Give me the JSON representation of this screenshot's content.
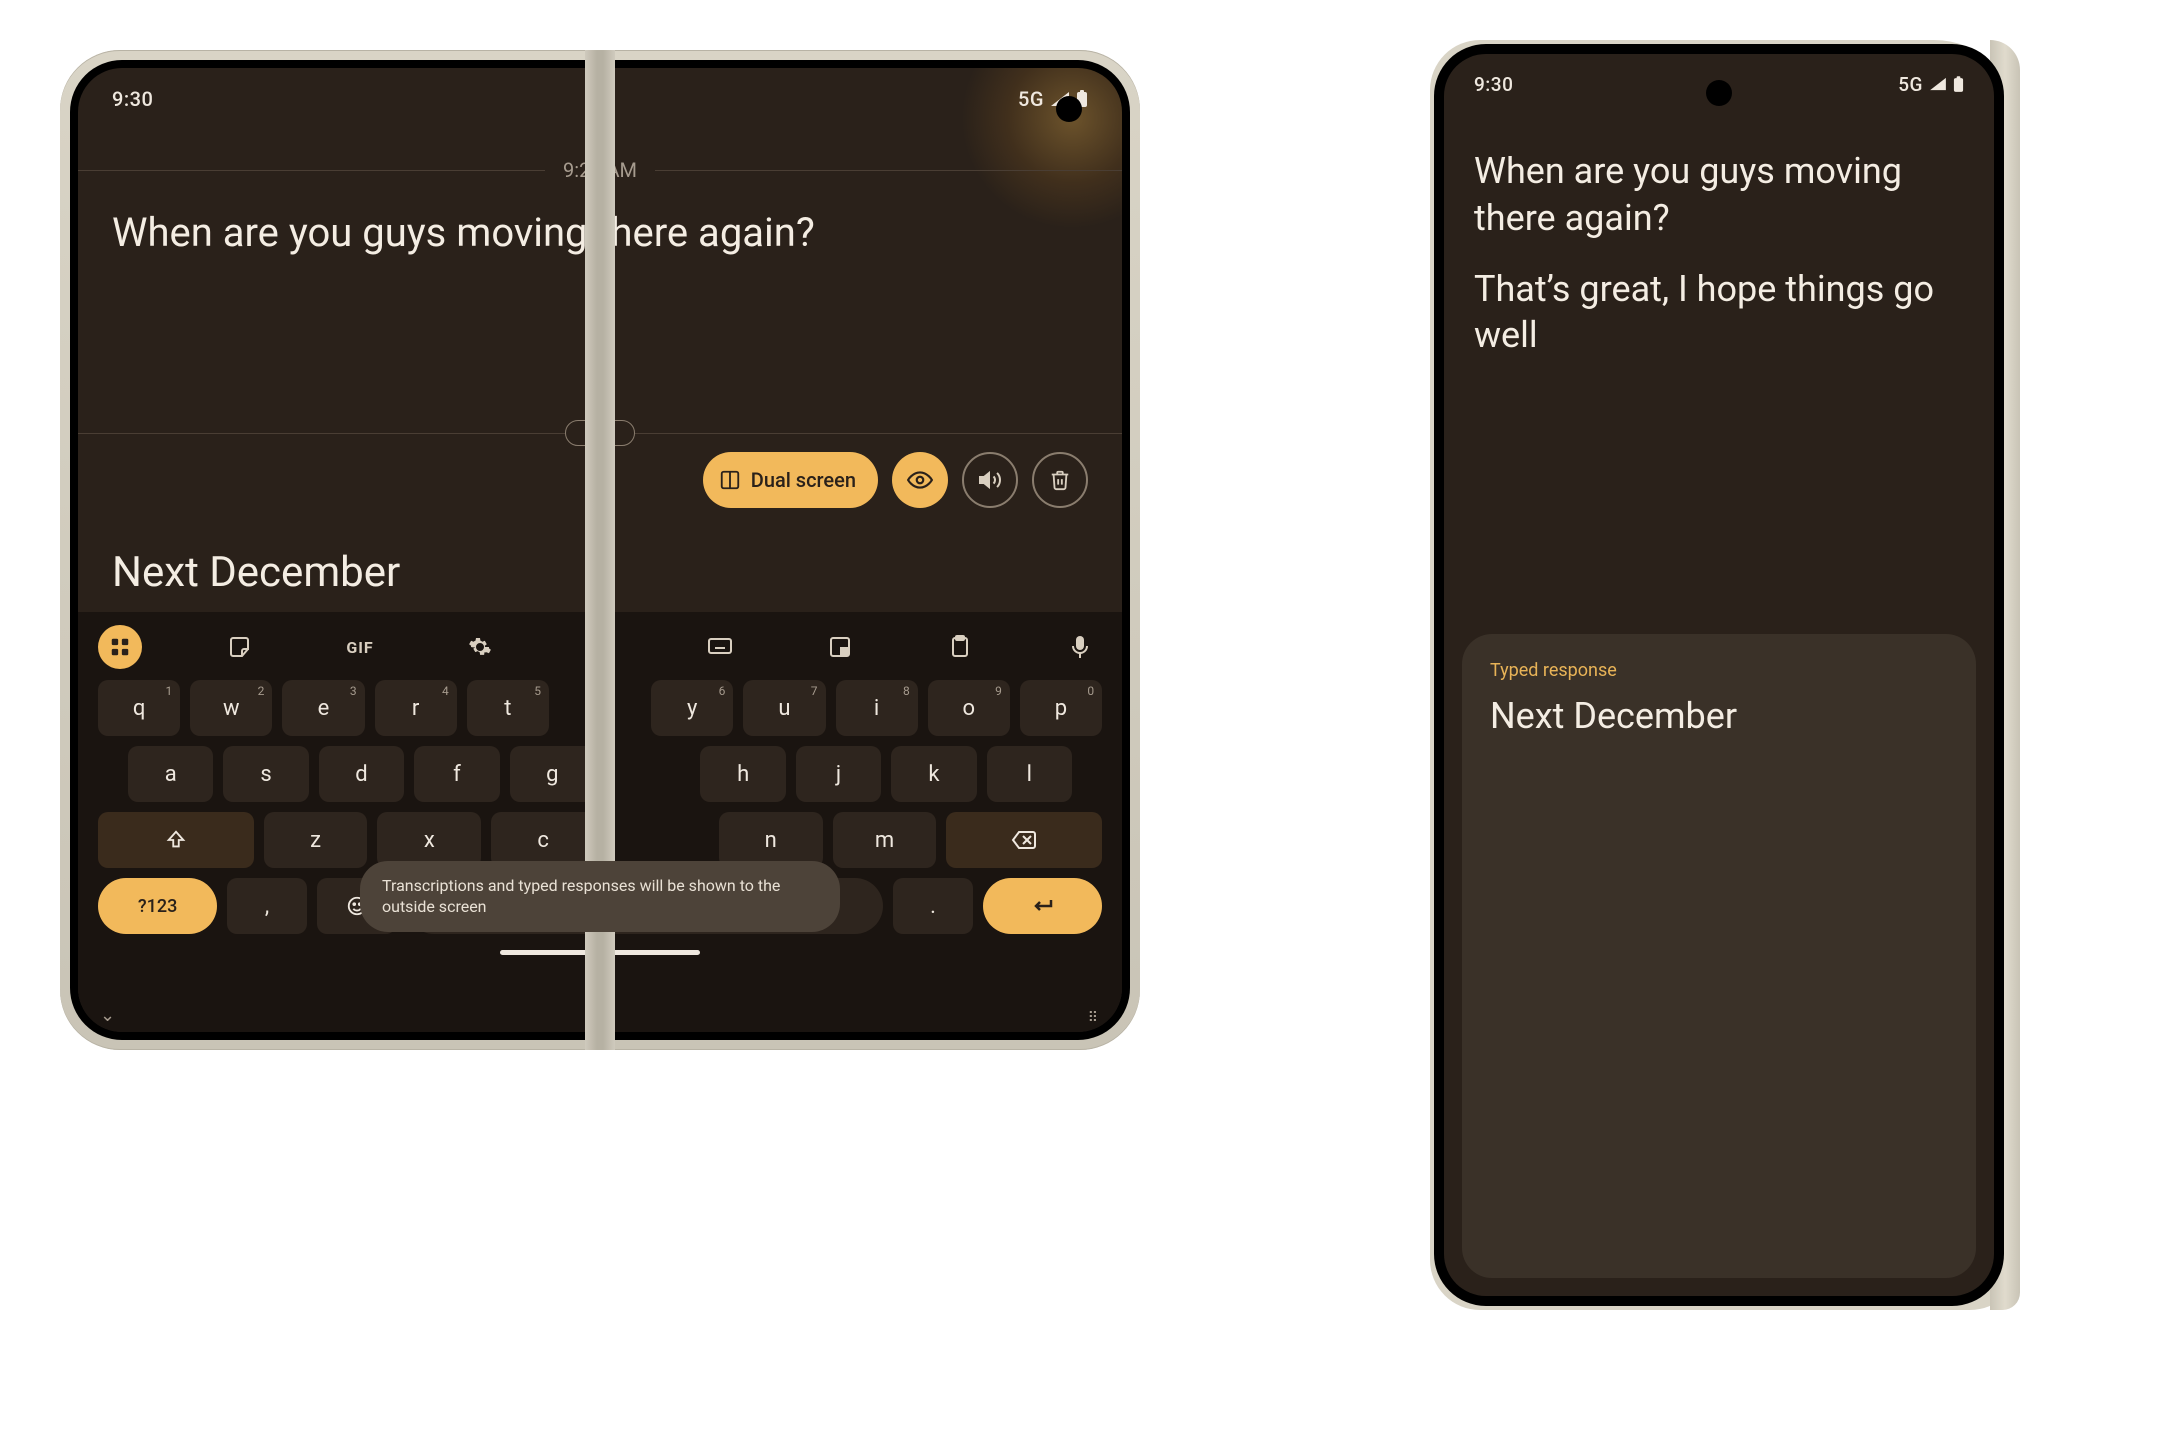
{
  "status": {
    "time": "9:30",
    "network": "5G"
  },
  "inner": {
    "timestamp": "9:29 AM",
    "transcript": "When are you guys moving there again?",
    "dual_screen_label": "Dual screen",
    "reply_text": "Next December",
    "toast": "Transcriptions and typed responses will be shown to the outside screen",
    "gif_label": "GIF",
    "num_key_label": "?123",
    "keys_row1_left": [
      "q",
      "w",
      "e",
      "r",
      "t"
    ],
    "keys_row1_left_sup": [
      "1",
      "2",
      "3",
      "4",
      "5"
    ],
    "keys_row1_right": [
      "y",
      "u",
      "i",
      "o",
      "p"
    ],
    "keys_row1_right_sup": [
      "6",
      "7",
      "8",
      "9",
      "0"
    ],
    "keys_row2_left": [
      "a",
      "s",
      "d",
      "f",
      "g"
    ],
    "keys_row2_right": [
      "h",
      "j",
      "k",
      "l"
    ],
    "keys_row3_left": [
      "z",
      "x",
      "c"
    ],
    "keys_row3_right": [
      "n",
      "m"
    ],
    "punct_comma": ",",
    "punct_period": "."
  },
  "outer": {
    "transcript_1": "When are you guys moving there again?",
    "transcript_2": "That’s great, I hope things go well",
    "card_label": "Typed response",
    "card_body": "Next December"
  }
}
